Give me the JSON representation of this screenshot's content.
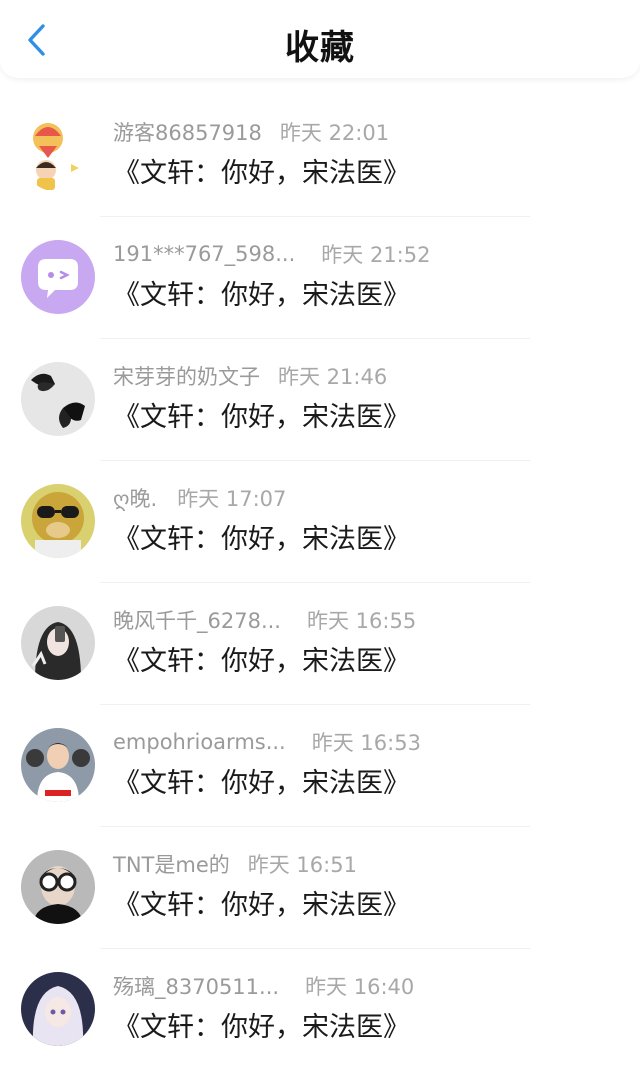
{
  "header": {
    "title": "收藏",
    "back_icon": "chevron-left-icon"
  },
  "accent": "#2f8fe6",
  "items": [
    {
      "username": "游客86857918",
      "time": "昨天 22:01",
      "content": "《文轩：你好，宋法医》",
      "avatar_icon": "balloon-cartoon-avatar"
    },
    {
      "username": "191***767_598...",
      "time": "昨天 21:52",
      "content": "《文轩：你好，宋法医》",
      "avatar_icon": "chat-bubble-avatar"
    },
    {
      "username": "宋芽芽的奶文子",
      "time": "昨天 21:46",
      "content": "《文轩：你好，宋法医》",
      "avatar_icon": "butterfly-avatar"
    },
    {
      "username": "ღ晚.",
      "time": "昨天 17:07",
      "content": "《文轩：你好，宋法医》",
      "avatar_icon": "monkey-sunglasses-avatar"
    },
    {
      "username": "晚风千千_6278...",
      "time": "昨天 16:55",
      "content": "《文轩：你好，宋法医》",
      "avatar_icon": "selfie-girl-avatar"
    },
    {
      "username": "empohrioarms...",
      "time": "昨天 16:53",
      "content": "《文轩：你好，宋法医》",
      "avatar_icon": "man-white-shirt-avatar"
    },
    {
      "username": "TNT是me的",
      "time": "昨天 16:51",
      "content": "《文轩：你好，宋法医》",
      "avatar_icon": "boy-glasses-avatar"
    },
    {
      "username": "殇璃_8370511...",
      "time": "昨天 16:40",
      "content": "《文轩：你好，宋法医》",
      "avatar_icon": "anime-girl-avatar"
    }
  ]
}
